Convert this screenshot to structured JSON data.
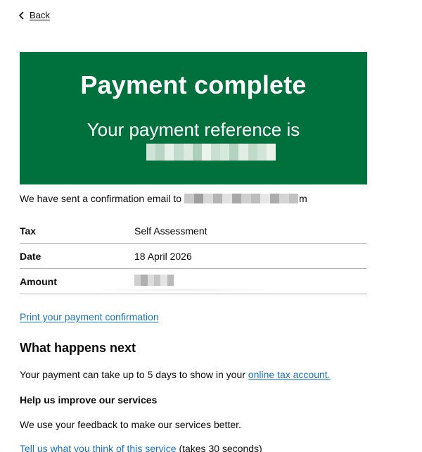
{
  "nav": {
    "back_label": "Back"
  },
  "panel": {
    "title": "Payment complete",
    "body": "Your payment reference is",
    "reference_redacted": true
  },
  "confirmation": {
    "prefix": "We have sent a confirmation email to",
    "email_visible_tail": "m"
  },
  "summary": {
    "rows": [
      {
        "key": "Tax",
        "value": "Self Assessment"
      },
      {
        "key": "Date",
        "value": "18 April 2026"
      },
      {
        "key": "Amount",
        "value": ""
      }
    ]
  },
  "links": {
    "print": "Print your payment confirmation",
    "online_account": "online tax account.",
    "feedback": "Tell us what you think of this service"
  },
  "sections": {
    "what_next_heading": "What happens next",
    "what_next_text": "Your payment can take up to 5 days to show in your",
    "improve_heading": "Help us improve our services",
    "improve_text": "We use your feedback to make our services better.",
    "feedback_suffix": "(takes 30 seconds)"
  },
  "colors": {
    "panel_bg": "#00703c",
    "link": "#1d70b8",
    "text": "#0b0c0c",
    "border": "#b1b4b6"
  },
  "icons": {
    "back": "chevron-left-icon"
  }
}
